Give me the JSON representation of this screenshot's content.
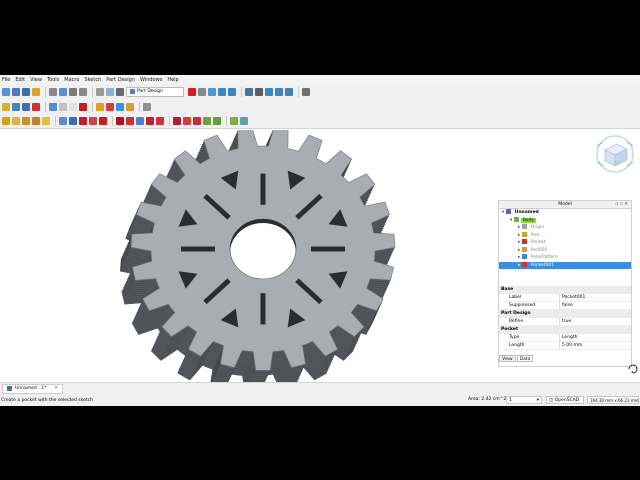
{
  "menu": [
    "File",
    "Edit",
    "View",
    "Tools",
    "Macro",
    "Sketch",
    "Part Design",
    "Windows",
    "Help"
  ],
  "toolbar": {
    "workbench": "Part Design"
  },
  "icons": {
    "row1": [
      "#5a8fd8",
      "#4c7bbf",
      "#3c6fae",
      "#e0a030",
      "#8a8a8a",
      "#5a8fd8",
      "#7a7a7a",
      "#8a8a8a",
      "#9a9a9a",
      "#8fb0d0",
      "#6a6a6a",
      "#d02020",
      "#8a8a8a",
      "#4a9ad8",
      "#3a8ac0",
      "#3a8ac0",
      "#5070a0",
      "#606060",
      "#3a8ac0",
      "#3a8ac0",
      "#4a80b0",
      "#707070"
    ],
    "row2": [
      "#d8b020",
      "#4a80c0",
      "#3a70b0",
      "#d03030",
      "#5090d0",
      "#c0c0c0",
      "#e0e0e0",
      "#c02020",
      "#e0a020",
      "#d04040",
      "#4090e0",
      "#d0a030",
      "#909090"
    ],
    "row3": [
      "#d8a020",
      "#e0b040",
      "#d09020",
      "#c08030",
      "#e0c040",
      "#5a8fd0",
      "#3a70b0",
      "#c02030",
      "#d04050",
      "#c02020",
      "#b01020",
      "#d03030",
      "#5080d0",
      "#c02030",
      "#d03040",
      "#b02030",
      "#d04040",
      "#c03040",
      "#70a040",
      "#60a040",
      "#80b040",
      "#60a0b0"
    ]
  },
  "tree": {
    "title": "Model",
    "items": [
      {
        "label": "Unnamed",
        "level": 0,
        "style": "bold",
        "icon": "#5070a0"
      },
      {
        "label": "Body",
        "level": 1,
        "style": "green",
        "icon": "#70b040"
      },
      {
        "label": "Origin",
        "level": 2,
        "style": "grey",
        "icon": "#a0a0a0"
      },
      {
        "label": "Pad",
        "level": 2,
        "style": "grey",
        "icon": "#d0a030"
      },
      {
        "label": "Pocket",
        "level": 2,
        "style": "grey",
        "icon": "#d03030"
      },
      {
        "label": "Pad001",
        "level": 2,
        "style": "grey",
        "icon": "#d0a030"
      },
      {
        "label": "PolarPattern",
        "level": 2,
        "style": "grey",
        "icon": "#5080d0"
      },
      {
        "label": "Pocket001",
        "level": 2,
        "style": "blue",
        "icon": "#d03030"
      }
    ]
  },
  "properties": [
    {
      "group": "Base",
      "rows": [
        {
          "k": "Label",
          "v": "Pocket001"
        },
        {
          "k": "Suppressed",
          "v": "false"
        }
      ]
    },
    {
      "group": "Part Design",
      "rows": [
        {
          "k": "Refine",
          "v": "true"
        }
      ]
    },
    {
      "group": "Pocket",
      "rows": [
        {
          "k": "Type",
          "v": "Length"
        },
        {
          "k": "Length",
          "v": "5.00 mm"
        }
      ]
    }
  ],
  "panel_tabs": [
    "View",
    "Data"
  ],
  "doc_tab": "Unnamed : 1*",
  "status": {
    "message": "Create a pocket with the selected sketch",
    "area": "Area: 2.42 cm^2",
    "layer": "1",
    "nav_style": "OpenSCAD",
    "dimensions": "164.30 mm x 66.21 mm"
  },
  "colors": {
    "gear_face": "#a9adb3",
    "gear_side": "#55585d",
    "gear_hole": "#2b2c2f",
    "selection_blue": "#3d8ee0",
    "body_green": "#7ddc3a"
  }
}
